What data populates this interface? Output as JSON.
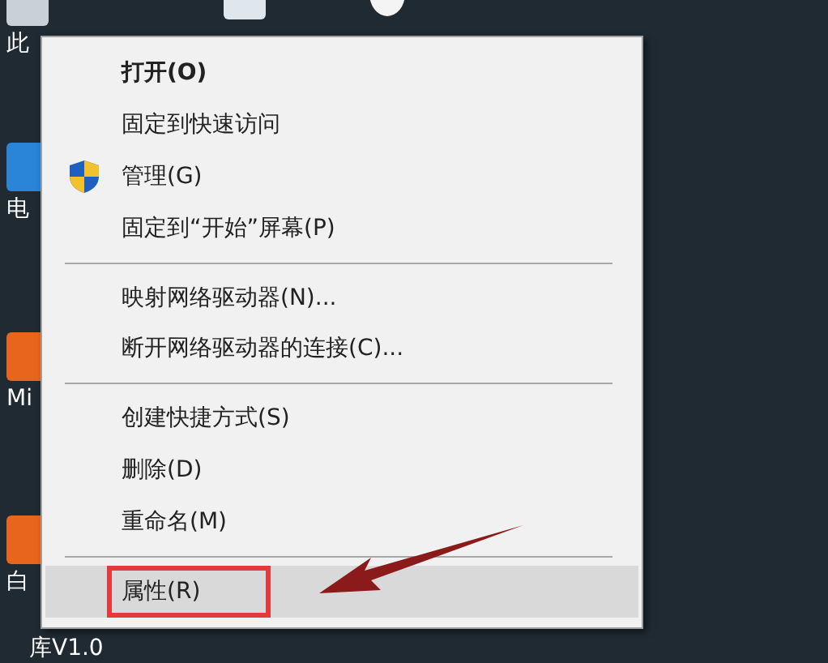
{
  "desktop_icons": [
    {
      "kind": "pc",
      "label": "此"
    },
    {
      "kind": "box"
    },
    {
      "kind": "penguin"
    },
    {
      "kind": "blue",
      "label": "电"
    },
    {
      "kind": "orange",
      "label": "Mi"
    },
    {
      "kind": "orange",
      "label": "白"
    },
    {
      "kind": "none",
      "label": "库V1.0"
    }
  ],
  "context_menu": {
    "items": [
      {
        "kind": "item",
        "label": "打开(O)",
        "bold": true,
        "icon": false,
        "selected": false,
        "annotated": false
      },
      {
        "kind": "item",
        "label": "固定到快速访问",
        "bold": false,
        "icon": false,
        "selected": false,
        "annotated": false
      },
      {
        "kind": "item",
        "label": "管理(G)",
        "bold": false,
        "icon": true,
        "selected": false,
        "annotated": false
      },
      {
        "kind": "item",
        "label": "固定到“开始”屏幕(P)",
        "bold": false,
        "icon": false,
        "selected": false,
        "annotated": false
      },
      {
        "kind": "separator"
      },
      {
        "kind": "item",
        "label": "映射网络驱动器(N)...",
        "bold": false,
        "icon": false,
        "selected": false,
        "annotated": false
      },
      {
        "kind": "item",
        "label": "断开网络驱动器的连接(C)...",
        "bold": false,
        "icon": false,
        "selected": false,
        "annotated": false
      },
      {
        "kind": "separator"
      },
      {
        "kind": "item",
        "label": "创建快捷方式(S)",
        "bold": false,
        "icon": false,
        "selected": false,
        "annotated": false
      },
      {
        "kind": "item",
        "label": "删除(D)",
        "bold": false,
        "icon": false,
        "selected": false,
        "annotated": false
      },
      {
        "kind": "item",
        "label": "重命名(M)",
        "bold": false,
        "icon": false,
        "selected": false,
        "annotated": false
      },
      {
        "kind": "separator"
      },
      {
        "kind": "item",
        "label": "属性(R)",
        "bold": false,
        "icon": false,
        "selected": true,
        "annotated": true
      }
    ]
  }
}
